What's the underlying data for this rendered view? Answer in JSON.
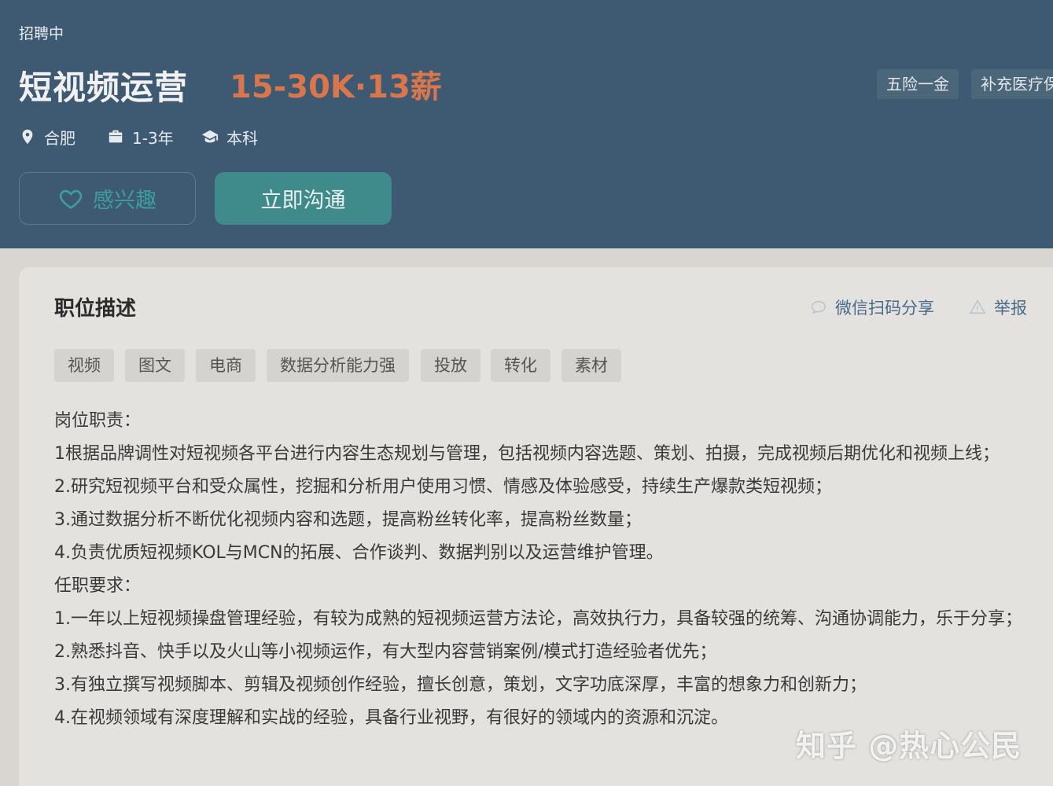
{
  "header": {
    "status": "招聘中",
    "title": "短视频运营",
    "salary": "15-30K·13薪",
    "welfare_tags": [
      "五险一金",
      "补充医疗保"
    ],
    "location": "合肥",
    "experience": "1-3年",
    "education": "本科",
    "interest_label": "感兴趣",
    "chat_label": "立即沟通"
  },
  "description": {
    "title": "职位描述",
    "share_label": "微信扫码分享",
    "report_label": "举报",
    "skill_tags": [
      "视频",
      "图文",
      "电商",
      "数据分析能力强",
      "投放",
      "转化",
      "素材"
    ],
    "lines": [
      "岗位职责：",
      "1根据品牌调性对短视频各平台进行内容生态规划与管理，包括视频内容选题、策划、拍摄，完成视频后期优化和视频上线；",
      "2.研究短视频平台和受众属性，挖掘和分析用户使用习惯、情感及体验感受，持续生产爆款类短视频；",
      "3.通过数据分析不断优化视频内容和选题，提高粉丝转化率，提高粉丝数量；",
      "4.负责优质短视频KOL与MCN的拓展、合作谈判、数据判别以及运营维护管理。",
      "任职要求：",
      "1.一年以上短视频操盘管理经验，有较为成熟的短视频运营方法论，高效执行力，具备较强的统筹、沟通协调能力，乐于分享；",
      "2.熟悉抖音、快手以及火山等小视频运作，有大型内容营销案例/模式打造经验者优先；",
      "3.有独立撰写视频脚本、剪辑及视频创作经验，擅长创意，策划，文字功底深厚，丰富的想象力和创新力；",
      "4.在视频领域有深度理解和实战的经验，具备行业视野，有很好的领域内的资源和沉淀。"
    ]
  },
  "watermark": "知乎 @热心公民",
  "icons": {
    "location": "location-pin-icon",
    "experience": "briefcase-icon",
    "education": "graduation-cap-icon",
    "interest": "heart-icon",
    "share": "chat-bubble-icon",
    "report": "warning-icon"
  },
  "colors": {
    "header_bg": "#3e5a72",
    "salary": "#d9764d",
    "chat_button": "#3f8a8b",
    "interest_accent": "#3d9ea0",
    "link": "#4a6a8a",
    "card_bg": "#e3e2df"
  }
}
